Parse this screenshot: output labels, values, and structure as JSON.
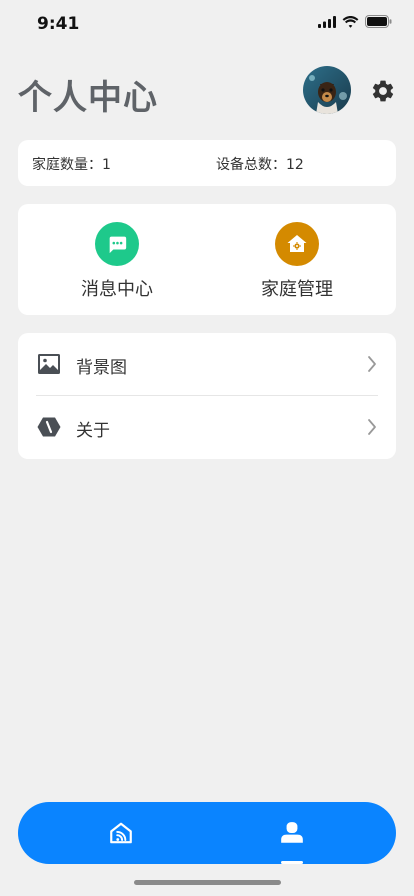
{
  "status_bar": {
    "time": "9:41",
    "icons": [
      "signal-icon",
      "wifi-icon",
      "battery-icon"
    ]
  },
  "header": {
    "title": "个人中心",
    "avatar": "avatar",
    "settings_icon": "gear-icon"
  },
  "stats": {
    "home_count": "家庭数量：1",
    "device_total": "设备总数：12"
  },
  "quick_actions": [
    {
      "label": "消息中心",
      "icon": "message-icon",
      "color": "#1ec98b"
    },
    {
      "label": "家庭管理",
      "icon": "home-settings-icon",
      "color": "#d48a00"
    }
  ],
  "menu": [
    {
      "label": "背景图",
      "icon": "image-icon"
    },
    {
      "label": "关于",
      "icon": "about-icon"
    }
  ],
  "tabbar": {
    "color": "#0a84ff",
    "tabs": [
      "home-icon",
      "profile-icon"
    ],
    "active": "profile"
  }
}
